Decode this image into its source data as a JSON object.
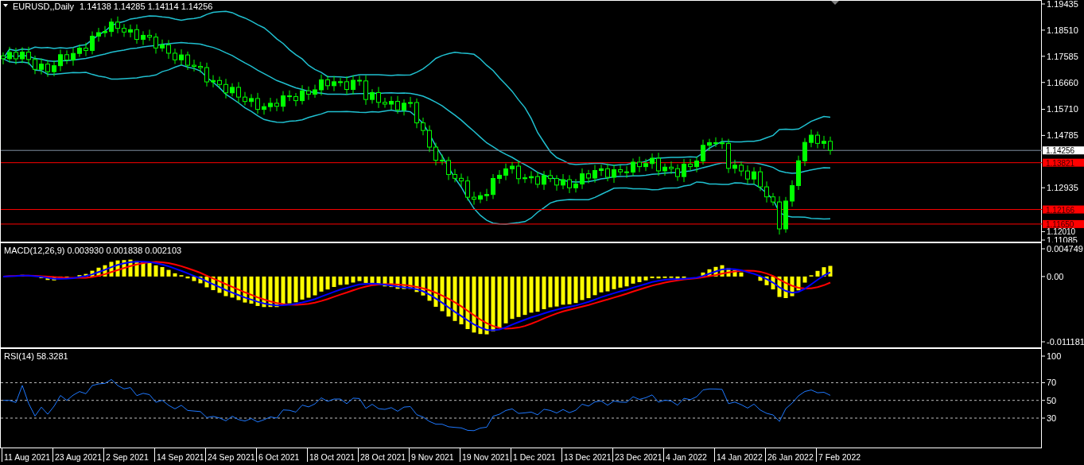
{
  "price_panel": {
    "symbol": "EURUSD,,Daily",
    "ohlc": [
      "1.14138",
      "1.14285",
      "1.14114",
      "1.14256"
    ],
    "axis_labels": [
      "1.19435",
      "1.18510",
      "1.17585",
      "1.16660",
      "1.15710",
      "1.14785",
      "1.12935",
      "1.12010",
      "1.11085"
    ],
    "levels": [
      {
        "kind": "bid",
        "label": "1.14256",
        "color": "#ffffff"
      },
      {
        "kind": "line",
        "label": "1.13821",
        "color": "#ff0000"
      },
      {
        "kind": "line",
        "label": "1.12166",
        "color": "#ff0000"
      },
      {
        "kind": "line",
        "label": "1.11650",
        "color": "#ff0000"
      }
    ]
  },
  "macd_panel": {
    "title": "MACD(12,26,9)",
    "values": [
      "0.003930",
      "0.001838",
      "0.002103"
    ],
    "axis_labels": [
      "0.004749",
      "0.00",
      "-0.011181"
    ]
  },
  "rsi_panel": {
    "title": "RSI(14)",
    "value": "58.3281",
    "axis_labels": [
      "100",
      "70",
      "50",
      "30"
    ]
  },
  "time_axis": [
    "11 Aug 2021",
    "23 Aug 2021",
    "2 Sep 2021",
    "14 Sep 2021",
    "24 Sep 2021",
    "6 Oct 2021",
    "18 Oct 2021",
    "28 Oct 2021",
    "9 Nov 2021",
    "19 Nov 2021",
    "1 Dec 2021",
    "13 Dec 2021",
    "23 Dec 2021",
    "4 Jan 2022",
    "14 Jan 2022",
    "26 Jan 2022",
    "7 Feb 2022"
  ]
}
